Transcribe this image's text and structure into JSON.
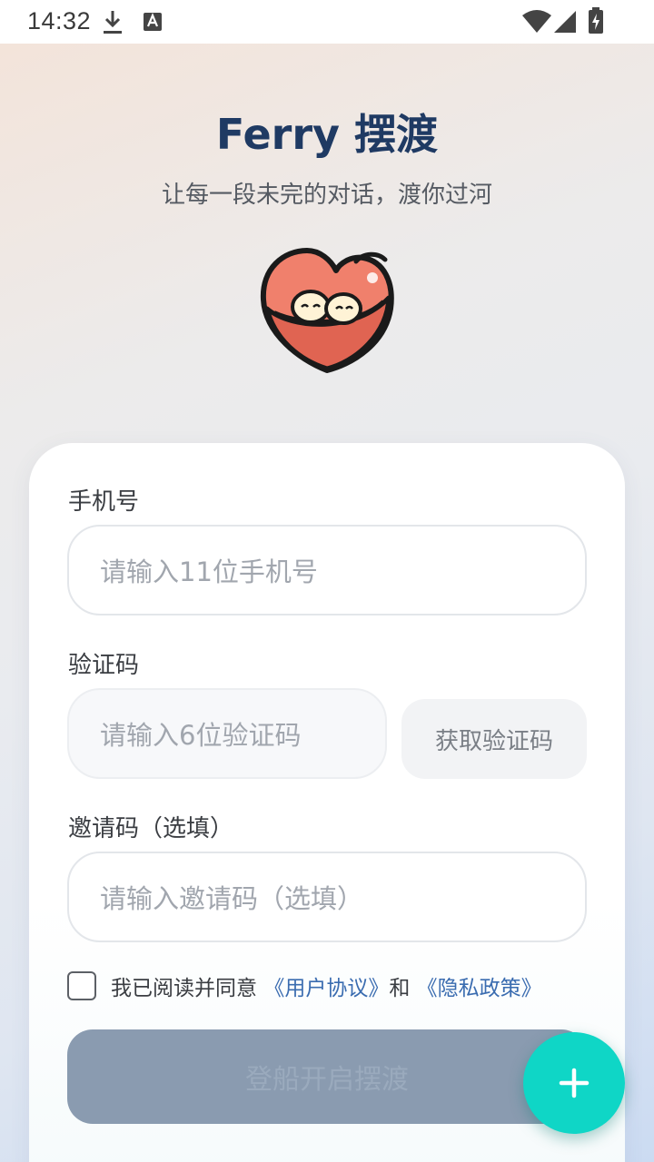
{
  "status_bar": {
    "time": "14:32",
    "icons": [
      "download-icon",
      "text-a-icon",
      "wifi-icon",
      "signal-icon",
      "battery-charging-icon"
    ]
  },
  "hero": {
    "title": "Ferry 摆渡",
    "subtitle": "让每一段未完的对话，渡你过河",
    "mascot": "heart-mascot-logo"
  },
  "form": {
    "phone": {
      "label": "手机号",
      "placeholder": "请输入11位手机号"
    },
    "code": {
      "label": "验证码",
      "placeholder": "请输入6位验证码",
      "button_label": "获取验证码"
    },
    "invite": {
      "label": "邀请码（选填）",
      "placeholder": "请输入邀请码（选填）"
    },
    "agreement": {
      "text_prefix": "我已阅读并同意",
      "user_agreement": "《用户协议》",
      "and": "和",
      "privacy_policy": "《隐私政策》",
      "checked": false
    },
    "submit_label": "登船开启摆渡"
  },
  "fab": {
    "icon": "plus-icon"
  },
  "colors": {
    "title": "#1f3a63",
    "link": "#3a6cb0",
    "submit_disabled": "#8a9bb0",
    "fab": "#0fd6c6",
    "mascot_heart": "#f0806c"
  }
}
